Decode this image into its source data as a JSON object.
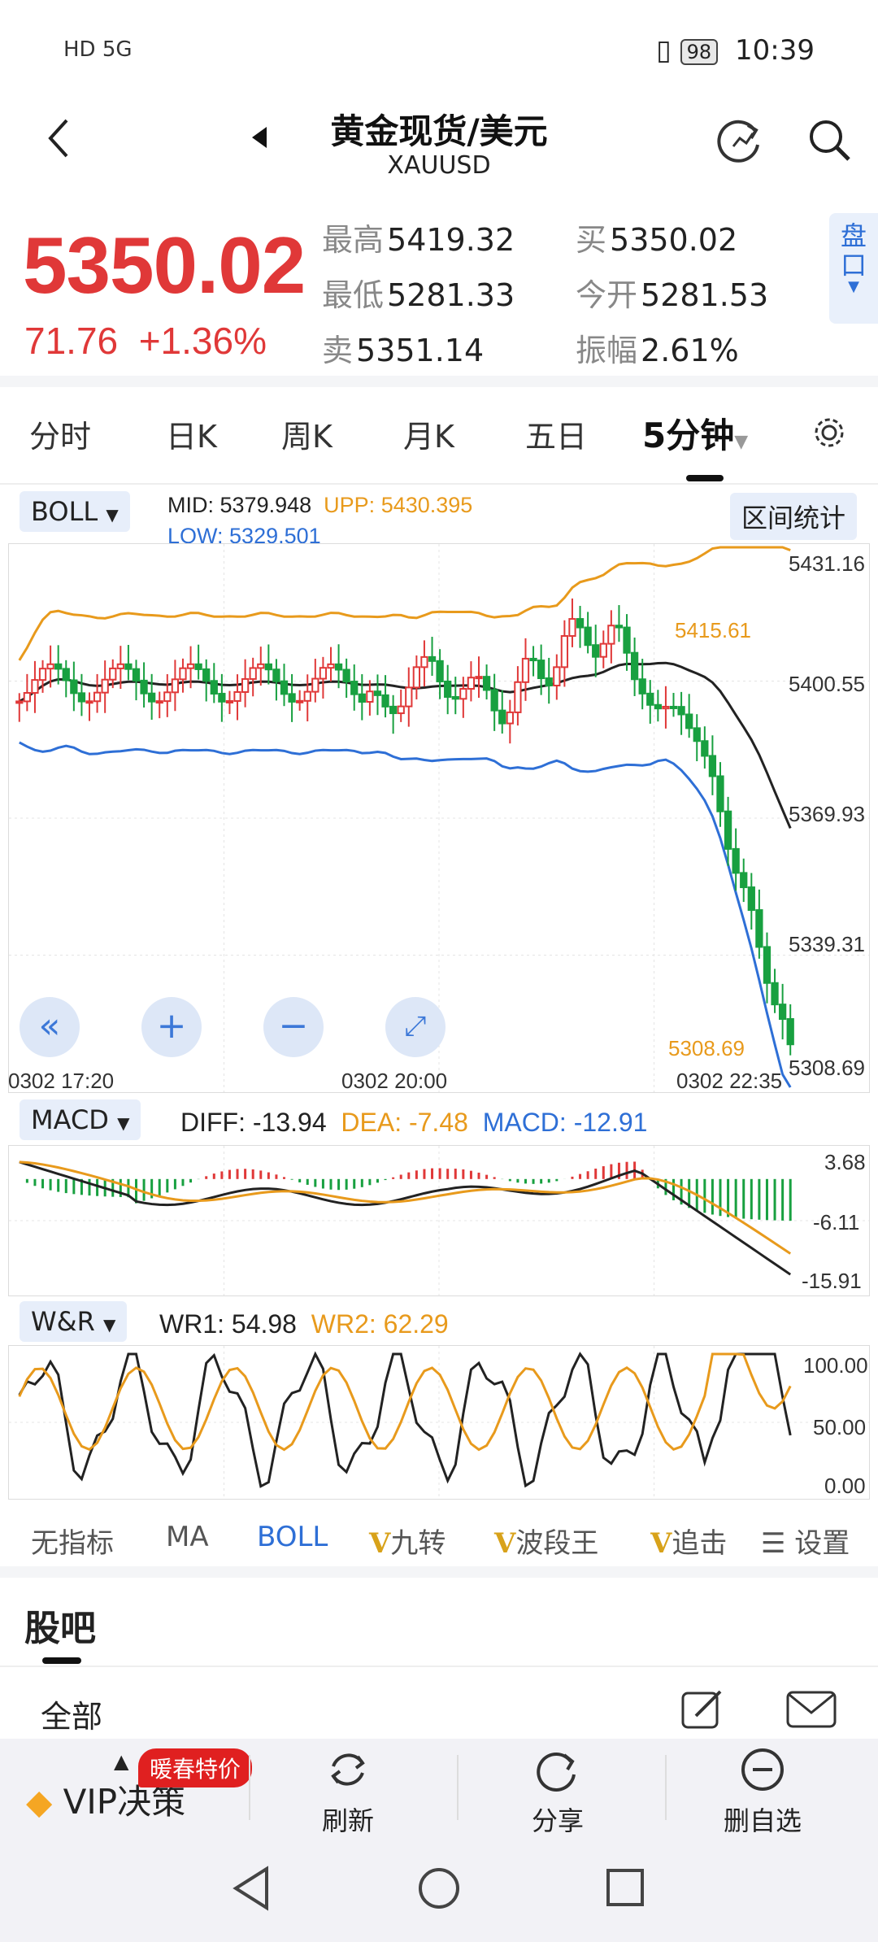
{
  "status_bar": {
    "left": "HD 5G",
    "battery": "98",
    "time": "10:39"
  },
  "header": {
    "title": "黄金现货/美元",
    "subtitle": "XAUUSD"
  },
  "quote": {
    "price": "5350.02",
    "change": "71.76",
    "change_pct": "+1.36%",
    "high_label": "最高",
    "high": "5419.32",
    "low_label": "最低",
    "low": "5281.33",
    "sell_label": "卖",
    "sell": "5351.14",
    "buy_label": "买",
    "buy": "5350.02",
    "open_label": "今开",
    "open": "5281.53",
    "amp_label": "振幅",
    "amp": "2.61%",
    "pankou": "盘口"
  },
  "tabs": [
    "分时",
    "日K",
    "周K",
    "月K",
    "五日",
    "5分钟"
  ],
  "active_tab": "5分钟",
  "main_chart": {
    "indicator": "BOLL",
    "mid_label": "MID:",
    "mid": "5379.948",
    "upp_label": "UPP:",
    "upp": "5430.395",
    "low_label": "LOW:",
    "low": "5329.501",
    "range_stat": "区间统计",
    "y_ticks": [
      "5431.16",
      "5400.55",
      "5369.93",
      "5339.31",
      "5308.69"
    ],
    "x_ticks": [
      "0302  17:20",
      "0302  20:00",
      "0302  22:35"
    ],
    "hi_annot": "5415.61",
    "lo_annot": "5308.69"
  },
  "macd": {
    "indicator": "MACD",
    "diff": "DIFF: -13.94",
    "dea": "DEA: -7.48",
    "macd": "MACD: -12.91",
    "y_ticks": [
      "3.68",
      "-6.11",
      "-15.91"
    ]
  },
  "wr": {
    "indicator": "W&R",
    "wr1": "WR1: 54.98",
    "wr2": "WR2: 62.29",
    "y_ticks": [
      "100.00",
      "50.00",
      "0.00"
    ]
  },
  "indicator_tabs": [
    "无指标",
    "MA",
    "BOLL",
    "九转",
    "波段王",
    "追击",
    "设置"
  ],
  "v_mark": "V",
  "guba": {
    "title": "股吧",
    "filter": "全部"
  },
  "bottom_nav": {
    "badge": "暖春特价",
    "vip": "VIP决策",
    "refresh": "刷新",
    "share": "分享",
    "remove": "删自选"
  },
  "colors": {
    "up": "#e03838",
    "down": "#18a040",
    "accent": "#2e6fd6",
    "orange": "#e89a1c"
  }
}
